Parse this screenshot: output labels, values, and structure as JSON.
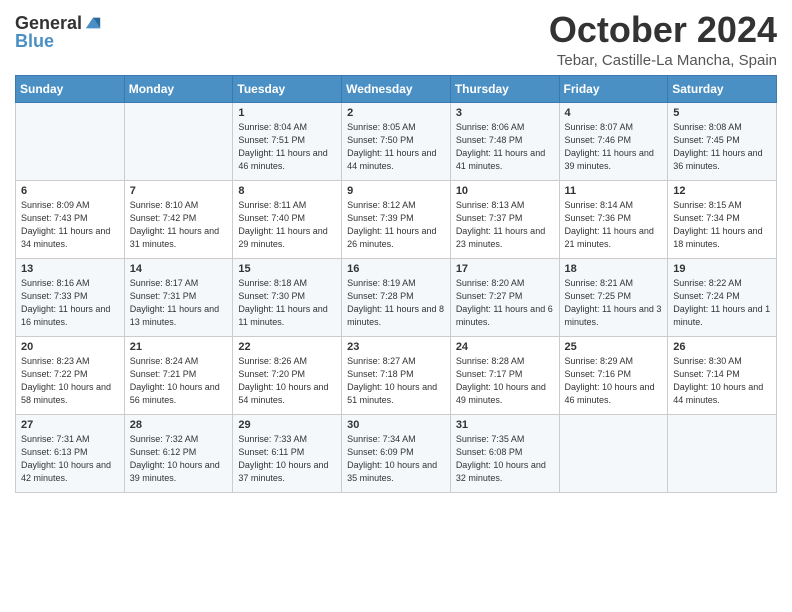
{
  "logo": {
    "general": "General",
    "blue": "Blue"
  },
  "title": {
    "month": "October 2024",
    "location": "Tebar, Castille-La Mancha, Spain"
  },
  "days_header": [
    "Sunday",
    "Monday",
    "Tuesday",
    "Wednesday",
    "Thursday",
    "Friday",
    "Saturday"
  ],
  "weeks": [
    [
      {
        "day": "",
        "info": ""
      },
      {
        "day": "",
        "info": ""
      },
      {
        "day": "1",
        "info": "Sunrise: 8:04 AM\nSunset: 7:51 PM\nDaylight: 11 hours and 46 minutes."
      },
      {
        "day": "2",
        "info": "Sunrise: 8:05 AM\nSunset: 7:50 PM\nDaylight: 11 hours and 44 minutes."
      },
      {
        "day": "3",
        "info": "Sunrise: 8:06 AM\nSunset: 7:48 PM\nDaylight: 11 hours and 41 minutes."
      },
      {
        "day": "4",
        "info": "Sunrise: 8:07 AM\nSunset: 7:46 PM\nDaylight: 11 hours and 39 minutes."
      },
      {
        "day": "5",
        "info": "Sunrise: 8:08 AM\nSunset: 7:45 PM\nDaylight: 11 hours and 36 minutes."
      }
    ],
    [
      {
        "day": "6",
        "info": "Sunrise: 8:09 AM\nSunset: 7:43 PM\nDaylight: 11 hours and 34 minutes."
      },
      {
        "day": "7",
        "info": "Sunrise: 8:10 AM\nSunset: 7:42 PM\nDaylight: 11 hours and 31 minutes."
      },
      {
        "day": "8",
        "info": "Sunrise: 8:11 AM\nSunset: 7:40 PM\nDaylight: 11 hours and 29 minutes."
      },
      {
        "day": "9",
        "info": "Sunrise: 8:12 AM\nSunset: 7:39 PM\nDaylight: 11 hours and 26 minutes."
      },
      {
        "day": "10",
        "info": "Sunrise: 8:13 AM\nSunset: 7:37 PM\nDaylight: 11 hours and 23 minutes."
      },
      {
        "day": "11",
        "info": "Sunrise: 8:14 AM\nSunset: 7:36 PM\nDaylight: 11 hours and 21 minutes."
      },
      {
        "day": "12",
        "info": "Sunrise: 8:15 AM\nSunset: 7:34 PM\nDaylight: 11 hours and 18 minutes."
      }
    ],
    [
      {
        "day": "13",
        "info": "Sunrise: 8:16 AM\nSunset: 7:33 PM\nDaylight: 11 hours and 16 minutes."
      },
      {
        "day": "14",
        "info": "Sunrise: 8:17 AM\nSunset: 7:31 PM\nDaylight: 11 hours and 13 minutes."
      },
      {
        "day": "15",
        "info": "Sunrise: 8:18 AM\nSunset: 7:30 PM\nDaylight: 11 hours and 11 minutes."
      },
      {
        "day": "16",
        "info": "Sunrise: 8:19 AM\nSunset: 7:28 PM\nDaylight: 11 hours and 8 minutes."
      },
      {
        "day": "17",
        "info": "Sunrise: 8:20 AM\nSunset: 7:27 PM\nDaylight: 11 hours and 6 minutes."
      },
      {
        "day": "18",
        "info": "Sunrise: 8:21 AM\nSunset: 7:25 PM\nDaylight: 11 hours and 3 minutes."
      },
      {
        "day": "19",
        "info": "Sunrise: 8:22 AM\nSunset: 7:24 PM\nDaylight: 11 hours and 1 minute."
      }
    ],
    [
      {
        "day": "20",
        "info": "Sunrise: 8:23 AM\nSunset: 7:22 PM\nDaylight: 10 hours and 58 minutes."
      },
      {
        "day": "21",
        "info": "Sunrise: 8:24 AM\nSunset: 7:21 PM\nDaylight: 10 hours and 56 minutes."
      },
      {
        "day": "22",
        "info": "Sunrise: 8:26 AM\nSunset: 7:20 PM\nDaylight: 10 hours and 54 minutes."
      },
      {
        "day": "23",
        "info": "Sunrise: 8:27 AM\nSunset: 7:18 PM\nDaylight: 10 hours and 51 minutes."
      },
      {
        "day": "24",
        "info": "Sunrise: 8:28 AM\nSunset: 7:17 PM\nDaylight: 10 hours and 49 minutes."
      },
      {
        "day": "25",
        "info": "Sunrise: 8:29 AM\nSunset: 7:16 PM\nDaylight: 10 hours and 46 minutes."
      },
      {
        "day": "26",
        "info": "Sunrise: 8:30 AM\nSunset: 7:14 PM\nDaylight: 10 hours and 44 minutes."
      }
    ],
    [
      {
        "day": "27",
        "info": "Sunrise: 7:31 AM\nSunset: 6:13 PM\nDaylight: 10 hours and 42 minutes."
      },
      {
        "day": "28",
        "info": "Sunrise: 7:32 AM\nSunset: 6:12 PM\nDaylight: 10 hours and 39 minutes."
      },
      {
        "day": "29",
        "info": "Sunrise: 7:33 AM\nSunset: 6:11 PM\nDaylight: 10 hours and 37 minutes."
      },
      {
        "day": "30",
        "info": "Sunrise: 7:34 AM\nSunset: 6:09 PM\nDaylight: 10 hours and 35 minutes."
      },
      {
        "day": "31",
        "info": "Sunrise: 7:35 AM\nSunset: 6:08 PM\nDaylight: 10 hours and 32 minutes."
      },
      {
        "day": "",
        "info": ""
      },
      {
        "day": "",
        "info": ""
      }
    ]
  ]
}
